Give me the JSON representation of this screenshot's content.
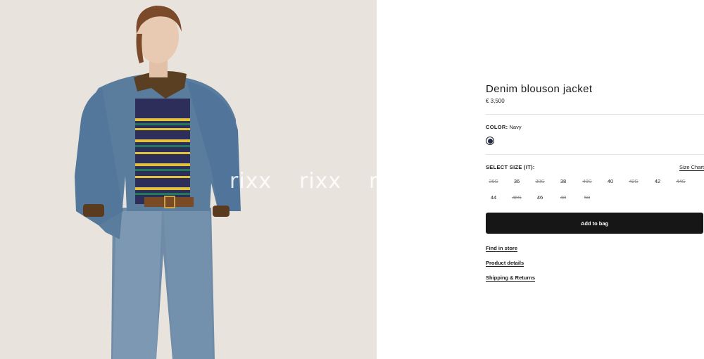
{
  "image": {
    "alt": "Model wearing denim blouson jacket",
    "watermark": [
      "rixx",
      "rixx",
      "ri"
    ]
  },
  "product": {
    "title": "Denim blouson jacket",
    "price": "€ 3,500"
  },
  "color": {
    "label": "COLOR:",
    "value": "Navy",
    "swatch_hex": "#1f2a45"
  },
  "size": {
    "label": "SELECT SIZE (IT):",
    "chart_link": "Size Chart",
    "options": [
      {
        "label": "36S",
        "available": false
      },
      {
        "label": "36",
        "available": true
      },
      {
        "label": "38S",
        "available": false
      },
      {
        "label": "38",
        "available": true
      },
      {
        "label": "40S",
        "available": false
      },
      {
        "label": "40",
        "available": true
      },
      {
        "label": "42S",
        "available": false
      },
      {
        "label": "42",
        "available": true
      },
      {
        "label": "44S",
        "available": false
      },
      {
        "label": "44",
        "available": true
      },
      {
        "label": "46S",
        "available": false
      },
      {
        "label": "46",
        "available": true
      },
      {
        "label": "48",
        "available": false
      },
      {
        "label": "50",
        "available": false
      }
    ]
  },
  "actions": {
    "add_to_bag": "Add to bag"
  },
  "links": {
    "find_in_store": "Find in store",
    "product_details": "Product details",
    "shipping_returns": "Shipping & Returns"
  }
}
